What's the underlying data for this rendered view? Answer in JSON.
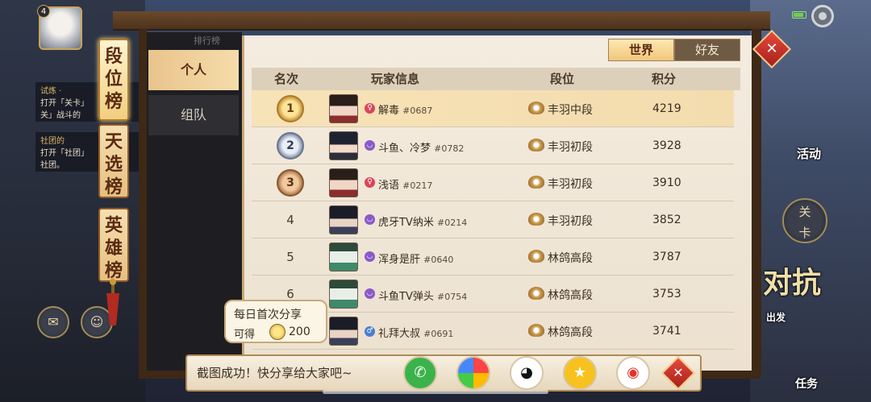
{
  "hud": {
    "level": "4",
    "quests": [
      {
        "title": "试炼 · ",
        "line1": "打开「关卡」",
        "line2": "关」战斗的"
      },
      {
        "title": "社团的",
        "line1": "打开「社团」",
        "line2": "社团。"
      }
    ],
    "right_menu": {
      "activity": "活动",
      "stage": "关卡",
      "versus_partial": "对抗",
      "attack": "出发",
      "task": "任务"
    }
  },
  "ranking_tabs": [
    "段位榜",
    "天选榜",
    "英雄榜"
  ],
  "sub_tabs": {
    "personal": "个人",
    "team": "组队",
    "faded": "排行榜"
  },
  "scope_tabs": {
    "world": "世界",
    "friends": "好友"
  },
  "table": {
    "headers": {
      "rank": "名次",
      "player": "玩家信息",
      "tier": "段位",
      "score": "积分"
    },
    "rows": [
      {
        "rank": "1",
        "gender": "f",
        "name": "解毒",
        "id": "#0687",
        "tier": "丰羽中段",
        "score": "4219"
      },
      {
        "rank": "2",
        "gender": "n",
        "name": "斗鱼、冷梦",
        "id": "#0782",
        "tier": "丰羽初段",
        "score": "3928"
      },
      {
        "rank": "3",
        "gender": "f",
        "name": "浅语",
        "id": "#0217",
        "tier": "丰羽初段",
        "score": "3910"
      },
      {
        "rank": "4",
        "gender": "n",
        "name": "虎牙TV纳米",
        "id": "#0214",
        "tier": "丰羽初段",
        "score": "3852"
      },
      {
        "rank": "5",
        "gender": "n",
        "name": "浑身是肝",
        "id": "#0640",
        "tier": "林鸽高段",
        "score": "3787"
      },
      {
        "rank": "6",
        "gender": "n",
        "name": "斗鱼TV弹头",
        "id": "#0754",
        "tier": "林鸽高段",
        "score": "3753"
      },
      {
        "rank": "",
        "gender": "m",
        "name": "礼拜大叔",
        "id": "#0691",
        "tier": "林鸽高段",
        "score": "3741"
      }
    ]
  },
  "share": {
    "message": "截图成功！快分享给大家吧~",
    "bubble_title": "每日首次分享",
    "bubble_prefix": "可得",
    "bubble_amount": "200",
    "icons": [
      "wechat-icon",
      "moments-icon",
      "qq-icon",
      "qzone-icon",
      "weibo-icon"
    ]
  },
  "colors": {
    "accent": "#f0c77c",
    "close_red": "#c42a20",
    "frame_wood": "#4c321c"
  }
}
